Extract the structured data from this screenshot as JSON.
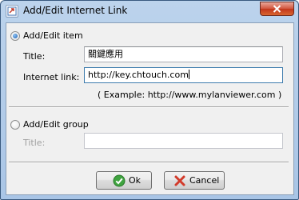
{
  "window": {
    "title": "Add/Edit Internet Link"
  },
  "item": {
    "radio_label": "Add/Edit item",
    "title_label": "Title:",
    "title_value": "關鍵應用",
    "link_label": "Internet link:",
    "link_value": "http://key.chtouch.com",
    "example": "( Example: http://www.mylanviewer.com )"
  },
  "group": {
    "radio_label": "Add/Edit group",
    "title_label": "Title:",
    "title_value": ""
  },
  "buttons": {
    "ok": "Ok",
    "cancel": "Cancel"
  },
  "icons": {
    "title": "app-link-icon",
    "close": "close-x-icon",
    "ok": "green-check-icon",
    "cancel": "red-x-icon"
  }
}
